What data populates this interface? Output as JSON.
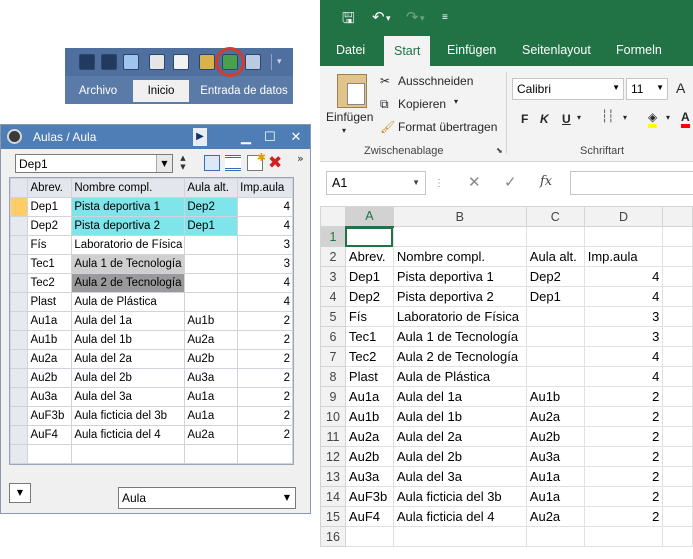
{
  "app_toolbar": {
    "tabs": [
      "Archivo",
      "Inicio",
      "Entrada de datos"
    ],
    "active_tab": "Inicio"
  },
  "window": {
    "title": "Aulas / Aula",
    "minimize": "▁",
    "maximize": "☐",
    "close": "✕",
    "selector_value": "Dep1",
    "more": "»",
    "bottom_select_value": "Aula",
    "columns": [
      "Abrev.",
      "Nombre compl.",
      "Aula alt.",
      "Imp.aula"
    ],
    "rows": [
      {
        "abrev": "Dep1",
        "nombre": "Pista deportiva 1",
        "alt": "Dep2",
        "imp": "4"
      },
      {
        "abrev": "Dep2",
        "nombre": "Pista deportiva 2",
        "alt": "Dep1",
        "imp": "4"
      },
      {
        "abrev": "Fís",
        "nombre": "Laboratorio de Física",
        "alt": "",
        "imp": "3"
      },
      {
        "abrev": "Tec1",
        "nombre": "Aula 1 de Tecnología",
        "alt": "",
        "imp": "3"
      },
      {
        "abrev": "Tec2",
        "nombre": "Aula 2 de Tecnología",
        "alt": "",
        "imp": "4"
      },
      {
        "abrev": "Plast",
        "nombre": "Aula de Plástica",
        "alt": "",
        "imp": "4"
      },
      {
        "abrev": "Au1a",
        "nombre": "Aula del 1a",
        "alt": "Au1b",
        "imp": "2"
      },
      {
        "abrev": "Au1b",
        "nombre": "Aula del 1b",
        "alt": "Au2a",
        "imp": "2"
      },
      {
        "abrev": "Au2a",
        "nombre": "Aula del 2a",
        "alt": "Au2b",
        "imp": "2"
      },
      {
        "abrev": "Au2b",
        "nombre": "Aula del 2b",
        "alt": "Au3a",
        "imp": "2"
      },
      {
        "abrev": "Au3a",
        "nombre": "Aula del 3a",
        "alt": "Au1a",
        "imp": "2"
      },
      {
        "abrev": "AuF3b",
        "nombre": "Aula ficticia del 3b",
        "alt": "Au1a",
        "imp": "2"
      },
      {
        "abrev": "AuF4",
        "nombre": "Aula ficticia del 4",
        "alt": "Au2a",
        "imp": "2"
      }
    ]
  },
  "excel": {
    "tabs": [
      "Datei",
      "Start",
      "Einfügen",
      "Seitenlayout",
      "Formeln"
    ],
    "active_tab": "Start",
    "ribbon": {
      "paste": "Einfügen",
      "cut": "Ausschneiden",
      "copy": "Kopieren",
      "format_painter": "Format übertragen",
      "clipboard_group": "Zwischenablage",
      "font_name": "Calibri",
      "font_size": "11",
      "bold": "F",
      "italic": "K",
      "underline": "U",
      "font_group": "Schriftart"
    },
    "name_box": "A1",
    "fx": "fx",
    "col_headers": [
      "A",
      "B",
      "C",
      "D"
    ],
    "row_numbers": [
      "1",
      "2",
      "3",
      "4",
      "5",
      "6",
      "7",
      "8",
      "9",
      "10",
      "11",
      "12",
      "13",
      "14",
      "15",
      "16"
    ],
    "rows": [
      [
        "",
        "",
        "",
        ""
      ],
      [
        "Abrev.",
        "Nombre compl.",
        "Aula alt.",
        "Imp.aula"
      ],
      [
        "Dep1",
        "Pista deportiva 1",
        "Dep2",
        "4"
      ],
      [
        "Dep2",
        "Pista deportiva 2",
        "Dep1",
        "4"
      ],
      [
        "Fís",
        "Laboratorio de Física",
        "",
        "3"
      ],
      [
        "Tec1",
        "Aula 1 de Tecnología",
        "",
        "3"
      ],
      [
        "Tec2",
        "Aula 2 de Tecnología",
        "",
        "4"
      ],
      [
        "Plast",
        "Aula de Plástica",
        "",
        "4"
      ],
      [
        "Au1a",
        "Aula del 1a",
        "Au1b",
        "2"
      ],
      [
        "Au1b",
        "Aula del 1b",
        "Au2a",
        "2"
      ],
      [
        "Au2a",
        "Aula del 2a",
        "Au2b",
        "2"
      ],
      [
        "Au2b",
        "Aula del 2b",
        "Au3a",
        "2"
      ],
      [
        "Au3a",
        "Aula del 3a",
        "Au1a",
        "2"
      ],
      [
        "AuF3b",
        "Aula ficticia del 3b",
        "Au1a",
        "2"
      ],
      [
        "AuF4",
        "Aula ficticia del 4",
        "Au2a",
        "2"
      ],
      [
        "",
        "",
        "",
        ""
      ]
    ]
  },
  "colors": {
    "excel_green": "#217346",
    "app_blue": "#5a7aa8",
    "highlight_red": "#d23c2a",
    "cyan_cell": "#7fe5ea"
  }
}
